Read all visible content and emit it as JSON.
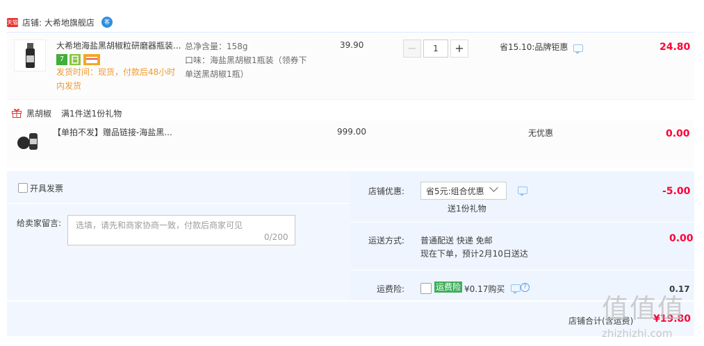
{
  "shop": {
    "tag": "天猫",
    "name": "店铺: 大希地旗舰店",
    "chat_badge": "客"
  },
  "item": {
    "title": "大希地海盐黑胡椒粒研磨器瓶装...",
    "shipping": "发货时间：现货，付款后48小时内发货",
    "badge_7": "7",
    "sku_1": "总净含量：158g",
    "sku_2": "口味：海盐黑胡椒1瓶装（领券下单送黑胡椒1瓶）",
    "price": "39.90",
    "qty": "1",
    "minus": "−",
    "plus": "+",
    "promo": "省15.10:品牌钜惠",
    "subtotal": "24.80"
  },
  "gift": {
    "name": "黑胡椒",
    "rule": "满1件送1份礼物",
    "title": "【单拍不发】赠品链接-海盐黑...",
    "price": "999.00",
    "promo": "无优惠",
    "subtotal": "0.00"
  },
  "invoice": {
    "label": "开具发票"
  },
  "message": {
    "label": "给卖家留言:",
    "placeholder": "选填，请先和商家协商一致，付款后商家可见",
    "count": "0/200"
  },
  "shop_discount": {
    "label": "店铺优惠:",
    "selected": "省5元:组合优惠",
    "note": "送1份礼物",
    "value": "-5.00"
  },
  "delivery": {
    "label": "运送方式:",
    "method": "普通配送 快递 免邮",
    "eta": "现在下单，预计2月10日送达",
    "value": "0.00"
  },
  "insurance": {
    "label": "运费险:",
    "tag": "运费险",
    "price": "¥0.17购买",
    "help": "?",
    "value": "0.17"
  },
  "total": {
    "label": "店铺合计(含运费)",
    "value": "¥19.80"
  },
  "watermark": {
    "mark": "值值值",
    "site": "zhizhizhi.com"
  },
  "colors": {
    "accent_red": "#ff0036",
    "link_blue": "#2f8fe0",
    "panel_bg": "#f2f7ff",
    "ship_orange": "#f09a2f"
  }
}
